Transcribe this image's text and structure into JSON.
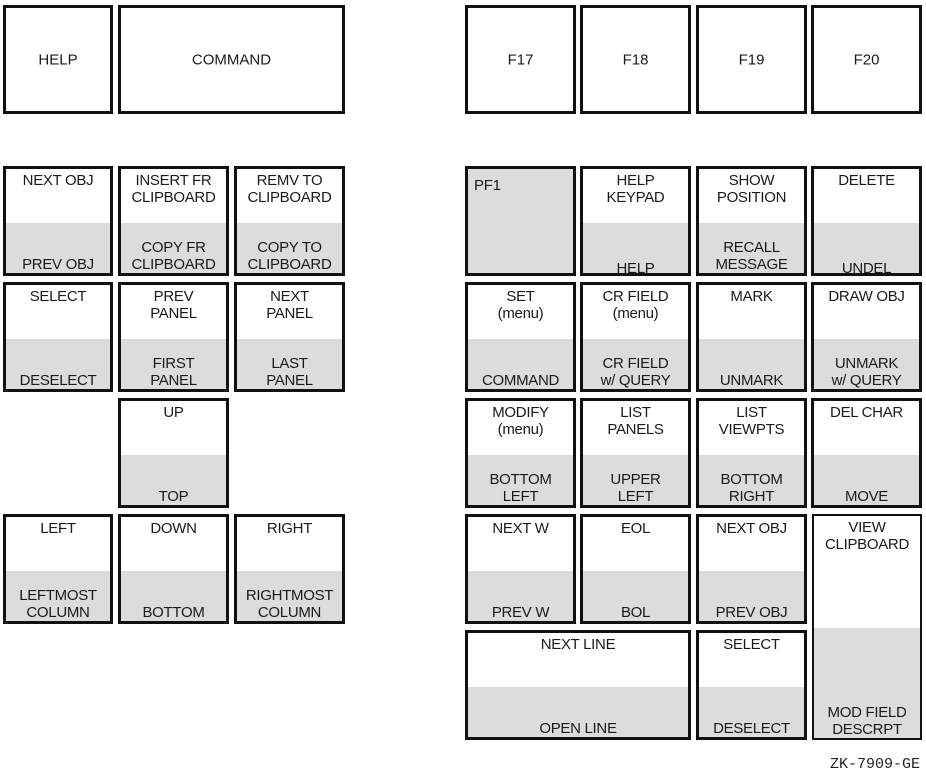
{
  "function_keys": {
    "help": "HELP",
    "command": "COMMAND",
    "f17": "F17",
    "f18": "F18",
    "f19": "F19",
    "f20": "F20"
  },
  "editing_keypad": {
    "find": {
      "top": "NEXT OBJ",
      "bottom": "PREV OBJ"
    },
    "insert": {
      "top": "INSERT FR\nCLIPBOARD",
      "bottom": "COPY FR\nCLIPBOARD"
    },
    "remove": {
      "top": "REMV TO\nCLIPBOARD",
      "bottom": "COPY TO\nCLIPBOARD"
    },
    "select": {
      "top": "SELECT",
      "bottom": "DESELECT"
    },
    "prev": {
      "top": "PREV\nPANEL",
      "bottom": "FIRST\nPANEL"
    },
    "next": {
      "top": "NEXT\nPANEL",
      "bottom": "LAST\nPANEL"
    }
  },
  "arrow_keys": {
    "up": {
      "top": "UP",
      "bottom": "TOP"
    },
    "left": {
      "top": "LEFT",
      "bottom": "LEFTMOST\nCOLUMN"
    },
    "down": {
      "top": "DOWN",
      "bottom": "BOTTOM"
    },
    "right": {
      "top": "RIGHT",
      "bottom": "RIGHTMOST\nCOLUMN"
    }
  },
  "numeric_keypad": {
    "pf1": {
      "top": "PF1"
    },
    "pf2": {
      "top": "HELP\nKEYPAD",
      "bottom": "HELP"
    },
    "pf3": {
      "top": "SHOW\nPOSITION",
      "bottom": "RECALL\nMESSAGE"
    },
    "pf4": {
      "top": "DELETE",
      "bottom": "UNDEL"
    },
    "k7": {
      "top": "SET\n(menu)",
      "bottom": "COMMAND"
    },
    "k8": {
      "top": "CR FIELD\n(menu)",
      "bottom": "CR FIELD\nw/ QUERY"
    },
    "k9": {
      "top": "MARK",
      "bottom": "UNMARK"
    },
    "minus": {
      "top": "DRAW OBJ",
      "bottom": "UNMARK\nw/ QUERY"
    },
    "k4": {
      "top": "MODIFY\n(menu)",
      "bottom": "BOTTOM\nLEFT"
    },
    "k5": {
      "top": "LIST\nPANELS",
      "bottom": "UPPER\nLEFT"
    },
    "k6": {
      "top": "LIST\nVIEWPTS",
      "bottom": "BOTTOM\nRIGHT"
    },
    "comma": {
      "top": "DEL CHAR",
      "bottom": "MOVE"
    },
    "k1": {
      "top": "NEXT W",
      "bottom": "PREV W"
    },
    "k2": {
      "top": "EOL",
      "bottom": "BOL"
    },
    "k3": {
      "top": "NEXT OBJ",
      "bottom": "PREV OBJ"
    },
    "enter": {
      "top": "VIEW\nCLIPBOARD",
      "bottom": "MOD FIELD\nDESCRPT"
    },
    "k0": {
      "top": "NEXT LINE",
      "bottom": "OPEN LINE"
    },
    "period": {
      "top": "SELECT",
      "bottom": "DESELECT"
    }
  },
  "caption": "ZK-7909-GE"
}
